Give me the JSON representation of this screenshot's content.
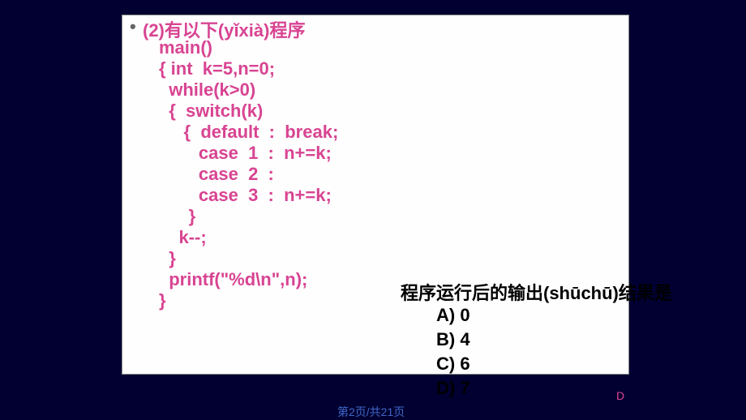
{
  "bullet": "•",
  "header": "(2)有以下(yǐxià)程序",
  "code": "main()\n{ int  k=5,n=0;\n  while(k>0)\n  {  switch(k)\n     {  default  :  break;\n        case  1  :  n+=k;\n        case  2  :\n        case  3  :  n+=k;\n      }\n    k--;\n  }\n  printf(\"%d\\n\",n);\n}",
  "question": "程序运行后的输出(shūchū)结果是",
  "options": {
    "a": "A)  0",
    "b": "B)  4",
    "c": "C)  6",
    "d": "D)  7"
  },
  "answer": "D",
  "pageNumber": "第2页/共21页"
}
